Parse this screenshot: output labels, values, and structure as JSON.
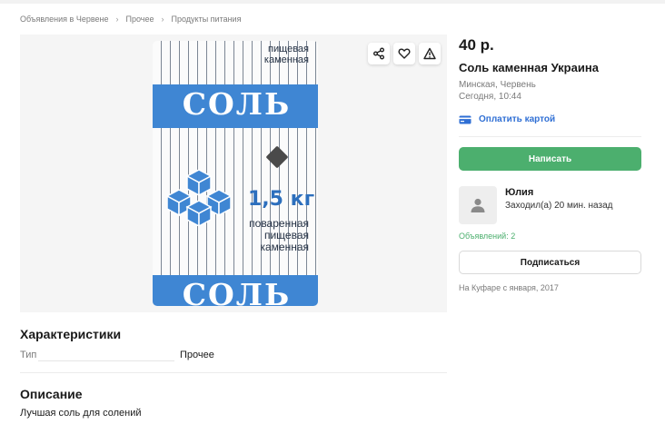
{
  "breadcrumbs": [
    "Объявления в Червене",
    "Прочее",
    "Продукты питания"
  ],
  "breadcrumb_separator": "›",
  "product_image": {
    "top_lines": [
      "пищевая",
      "каменная"
    ],
    "band_word": "СОЛЬ",
    "weight": "1,5 кг",
    "bottom_lines": [
      "поваренная",
      "пищевая",
      "каменная"
    ],
    "bottom_band_word": "СОЛЬ",
    "band_color": "#3f86d3"
  },
  "listing": {
    "price": "40 р.",
    "title": "Соль каменная Украина",
    "location": "Минская, Червень",
    "date": "Сегодня, 10:44",
    "pay_label": "Оплатить картой",
    "write_button": "Написать",
    "subscribe_button": "Подписаться"
  },
  "seller": {
    "name": "Юлия",
    "last_seen": "Заходил(а) 20 мин. назад",
    "ads_count": "Объявлений: 2",
    "since": "На Куфаре с января, 2017"
  },
  "characteristics": {
    "heading": "Характеристики",
    "rows": [
      {
        "key": "Тип",
        "value": "Прочее"
      }
    ]
  },
  "description": {
    "heading": "Описание",
    "text": "Лучшая соль для солений"
  },
  "colors": {
    "accent_green": "#4caf6e",
    "link_blue": "#2f6fd4"
  }
}
